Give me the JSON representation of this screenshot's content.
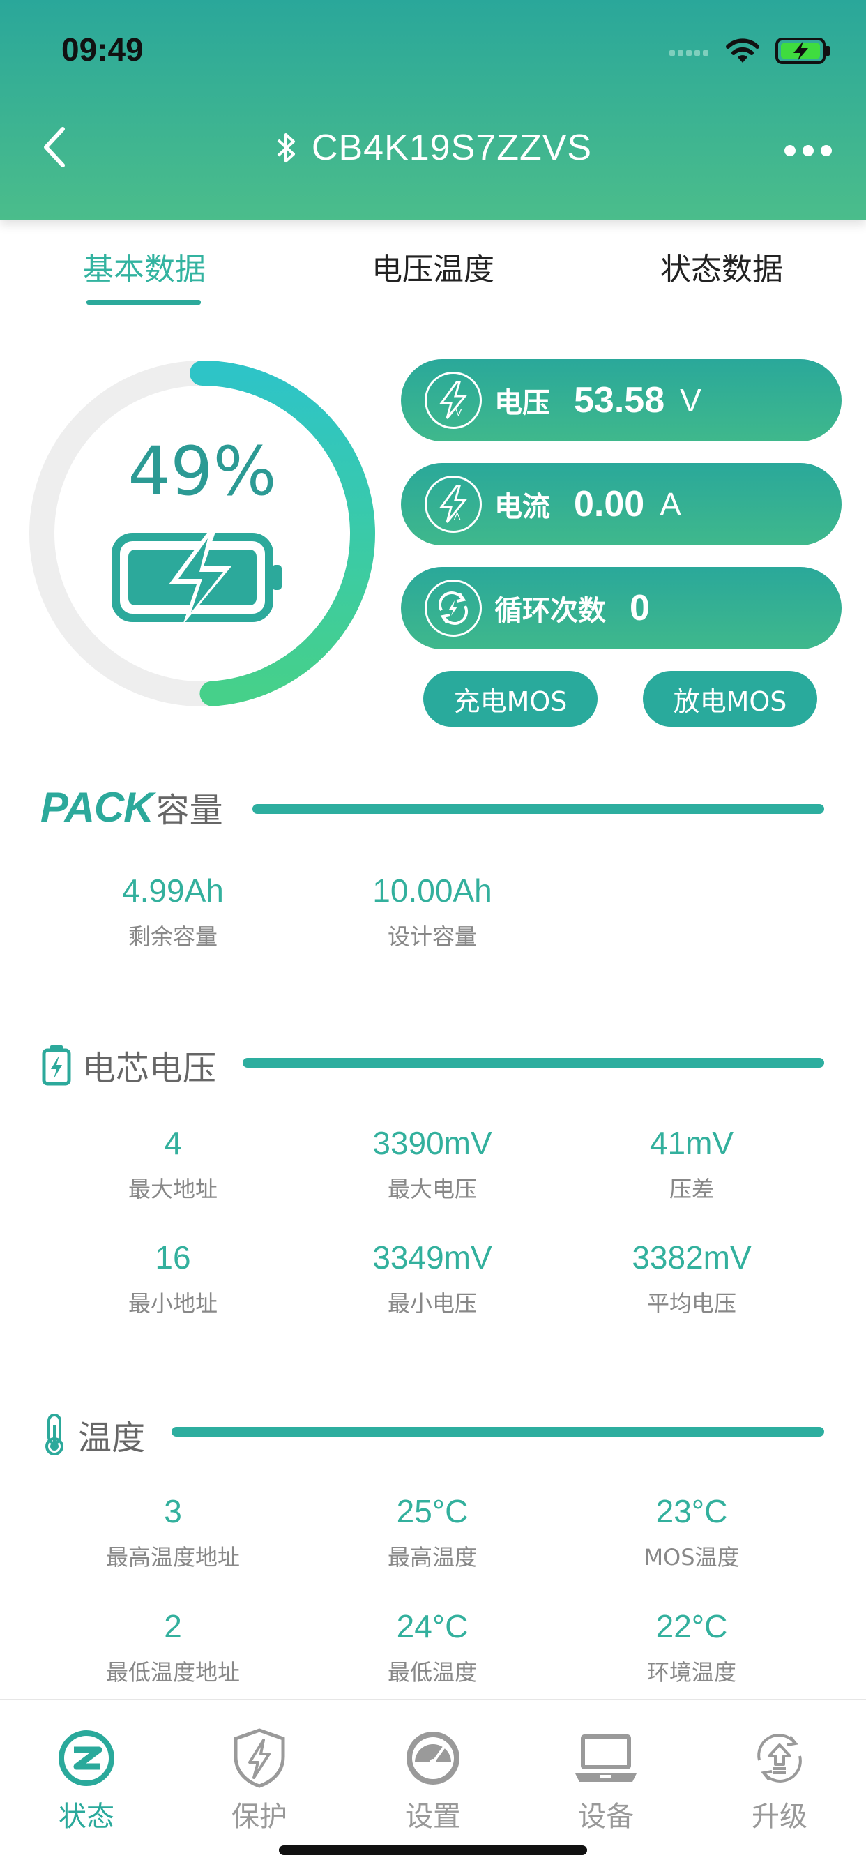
{
  "status_bar": {
    "time": "09:49"
  },
  "header": {
    "title": "CB4K19S7ZZVS"
  },
  "tabs": [
    {
      "label": "基本数据"
    },
    {
      "label": "电压温度"
    },
    {
      "label": "状态数据"
    }
  ],
  "gauge": {
    "percent_text": "49%",
    "level": 0.49
  },
  "pills": {
    "voltage": {
      "label": "电压",
      "value": "53.58",
      "unit": "V"
    },
    "current": {
      "label": "电流",
      "value": "0.00",
      "unit": "A"
    },
    "cycles": {
      "label": "循环次数",
      "value": "0"
    }
  },
  "mos": {
    "charge": "充电MOS",
    "discharge": "放电MOS"
  },
  "pack": {
    "title_brand": "PACK",
    "title_suffix": "容量",
    "stats": [
      {
        "value": "4.99Ah",
        "label": "剩余容量"
      },
      {
        "value": "10.00Ah",
        "label": "设计容量"
      }
    ]
  },
  "cell_voltage": {
    "title": "电芯电压",
    "stats": [
      {
        "value": "4",
        "label": "最大地址"
      },
      {
        "value": "3390mV",
        "label": "最大电压"
      },
      {
        "value": "41mV",
        "label": "压差"
      },
      {
        "value": "16",
        "label": "最小地址"
      },
      {
        "value": "3349mV",
        "label": "最小电压"
      },
      {
        "value": "3382mV",
        "label": "平均电压"
      }
    ]
  },
  "temperature": {
    "title": "温度",
    "stats": [
      {
        "value": "3",
        "label": "最高温度地址"
      },
      {
        "value": "25°C",
        "label": "最高温度"
      },
      {
        "value": "23°C",
        "label": "MOS温度"
      },
      {
        "value": "2",
        "label": "最低温度地址"
      },
      {
        "value": "24°C",
        "label": "最低温度"
      },
      {
        "value": "22°C",
        "label": "环境温度"
      }
    ]
  },
  "nav": [
    {
      "label": "状态",
      "icon": "status-icon"
    },
    {
      "label": "保护",
      "icon": "shield-bolt-icon"
    },
    {
      "label": "设置",
      "icon": "gauge-settings-icon"
    },
    {
      "label": "设备",
      "icon": "laptop-icon"
    },
    {
      "label": "升级",
      "icon": "upgrade-icon"
    }
  ],
  "colors": {
    "accent": "#2aa99b",
    "header_top": "#2aa79a",
    "header_bottom": "#4bbd8b",
    "value_text": "#33b09d"
  }
}
